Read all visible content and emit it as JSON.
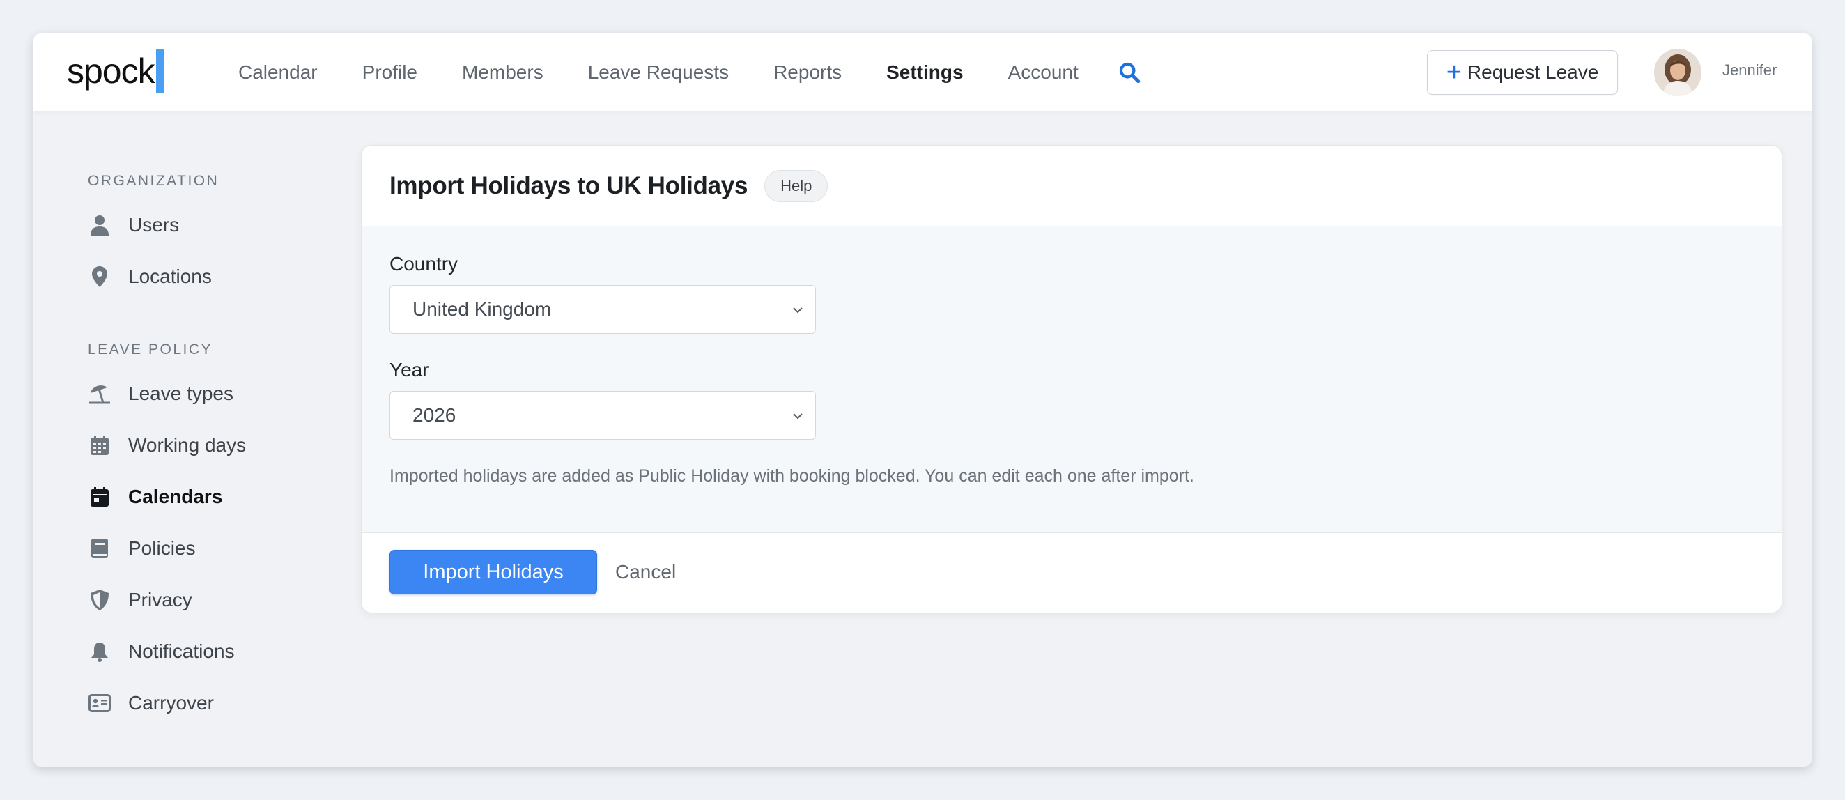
{
  "brand": {
    "logo_text": "spock"
  },
  "nav": {
    "items": [
      {
        "label": "Calendar"
      },
      {
        "label": "Profile"
      },
      {
        "label": "Members"
      },
      {
        "label": "Leave Requests"
      },
      {
        "label": "Reports"
      },
      {
        "label": "Settings",
        "active": true
      },
      {
        "label": "Account"
      }
    ],
    "search_icon": "search-icon"
  },
  "header": {
    "request_leave_label": "Request Leave",
    "user_name": "Jennifer"
  },
  "sidebar": {
    "sections": [
      {
        "title": "ORGANIZATION",
        "items": [
          {
            "label": "Users",
            "icon": "user-icon"
          },
          {
            "label": "Locations",
            "icon": "map-pin-icon"
          }
        ]
      },
      {
        "title": "LEAVE POLICY",
        "items": [
          {
            "label": "Leave types",
            "icon": "beach-umbrella-icon"
          },
          {
            "label": "Working days",
            "icon": "calendar-grid-icon"
          },
          {
            "label": "Calendars",
            "icon": "calendar-icon",
            "active": true
          },
          {
            "label": "Policies",
            "icon": "book-icon"
          },
          {
            "label": "Privacy",
            "icon": "shield-icon"
          },
          {
            "label": "Notifications",
            "icon": "bell-icon"
          },
          {
            "label": "Carryover",
            "icon": "id-card-icon"
          }
        ]
      }
    ]
  },
  "dialog": {
    "title": "Import Holidays to UK Holidays",
    "help_label": "Help",
    "country_label": "Country",
    "country_value": "United Kingdom",
    "year_label": "Year",
    "year_value": "2026",
    "hint": "Imported holidays are added as Public Holiday with booking blocked. You can edit each one after import.",
    "primary_label": "Import Holidays",
    "cancel_label": "Cancel"
  },
  "colors": {
    "accent": "#3b86f3",
    "brand_bar": "#4a9ff5",
    "search_icon": "#1f6fe0"
  }
}
